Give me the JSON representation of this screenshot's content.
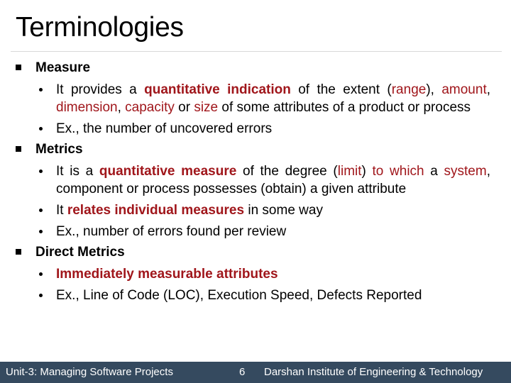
{
  "slide": {
    "title": "Terminologies",
    "sections": [
      {
        "heading": "Measure",
        "items": [
          {
            "segments": [
              {
                "t": "It provides a ",
                "s": ""
              },
              {
                "t": "quantitative indication",
                "s": "redb"
              },
              {
                "t": " of the extent (",
                "s": ""
              },
              {
                "t": "range",
                "s": "red"
              },
              {
                "t": "), ",
                "s": ""
              },
              {
                "t": "amount",
                "s": "red"
              },
              {
                "t": ", ",
                "s": ""
              },
              {
                "t": "dimension",
                "s": "red"
              },
              {
                "t": ", ",
                "s": ""
              },
              {
                "t": "capacity",
                "s": "red"
              },
              {
                "t": " or ",
                "s": ""
              },
              {
                "t": "size",
                "s": "red"
              },
              {
                "t": " of some attributes of a product or process",
                "s": ""
              }
            ]
          },
          {
            "segments": [
              {
                "t": "Ex., the number of uncovered errors",
                "s": ""
              }
            ]
          }
        ]
      },
      {
        "heading": "Metrics",
        "items": [
          {
            "segments": [
              {
                "t": "It is a ",
                "s": ""
              },
              {
                "t": "quantitative measure",
                "s": "redb"
              },
              {
                "t": " of the degree (",
                "s": ""
              },
              {
                "t": "limit",
                "s": "red"
              },
              {
                "t": ") ",
                "s": ""
              },
              {
                "t": "to which",
                "s": "red"
              },
              {
                "t": " a ",
                "s": ""
              },
              {
                "t": "system",
                "s": "red"
              },
              {
                "t": ", component or process possesses (obtain) a given attribute",
                "s": ""
              }
            ]
          },
          {
            "segments": [
              {
                "t": "It ",
                "s": ""
              },
              {
                "t": "relates individual measures",
                "s": "redb"
              },
              {
                "t": " in some way",
                "s": ""
              }
            ]
          },
          {
            "segments": [
              {
                "t": "Ex., number of errors found per review",
                "s": ""
              }
            ]
          }
        ]
      },
      {
        "heading": "Direct Metrics",
        "items": [
          {
            "segments": [
              {
                "t": "Immediately measurable attributes",
                "s": "redb"
              }
            ]
          },
          {
            "segments": [
              {
                "t": "Ex., Line of Code (LOC), Execution Speed, Defects Reported",
                "s": ""
              }
            ]
          }
        ]
      }
    ]
  },
  "footer": {
    "unit": "Unit-3: Managing Software Projects",
    "page_number": "6",
    "institute": "Darshan Institute of Engineering & Technology"
  },
  "colors": {
    "accent_red": "#a0161b",
    "footer_bg": "#354a5f",
    "divider": "#d8d8d8"
  }
}
